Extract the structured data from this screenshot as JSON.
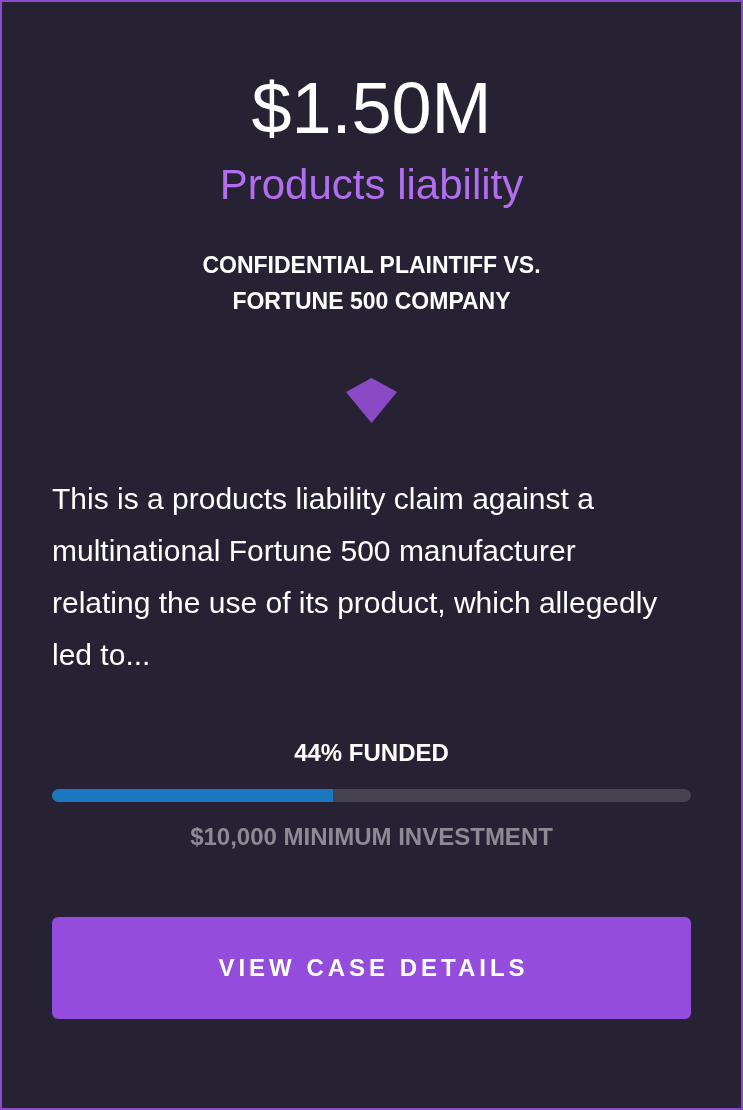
{
  "card": {
    "amount": "$1.50M",
    "category": "Products liability",
    "title": "CONFIDENTIAL PLAINTIFF VS. FORTUNE 500 COMPANY",
    "description": "This is a products liability claim against a multinational Fortune 500 manufacturer relating the use of its product, which allegedly led to...",
    "funding": {
      "label": "44% FUNDED",
      "level": 0.44
    },
    "minimum": "$10,000 MINIMUM INVESTMENT",
    "button": {
      "label": "VIEW CASE DETAILS"
    }
  }
}
